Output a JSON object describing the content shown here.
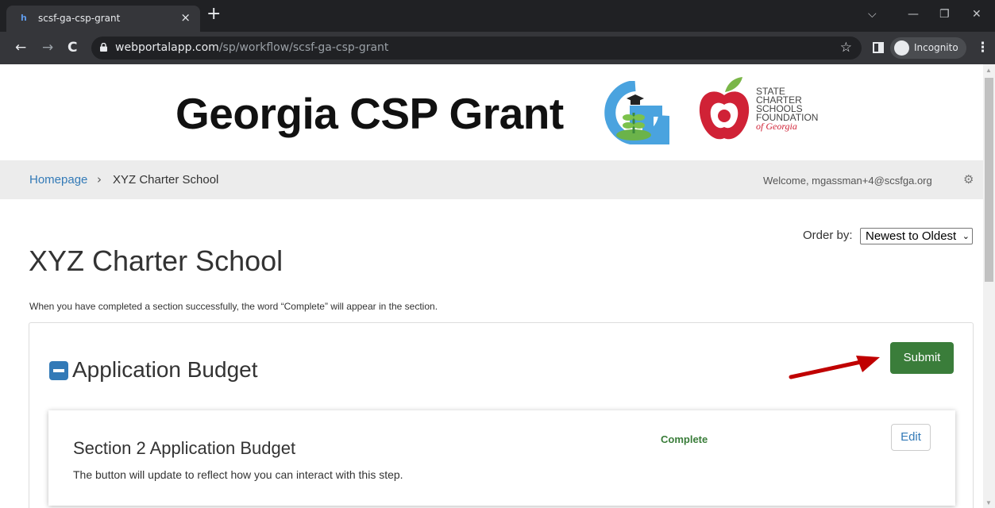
{
  "browser": {
    "tab_title": "scsf-ga-csp-grant",
    "tab_favicon": "h",
    "tab_close": "×",
    "new_tab": "+",
    "url_domain": "webportalapp.com",
    "url_path": "/sp/workflow/scsf-ga-csp-grant",
    "profile_label": "Incognito",
    "window_controls": {
      "chevron": "⌵",
      "minimize": "—",
      "restore": "❐",
      "close": "✕"
    },
    "nav": {
      "back": "←",
      "forward": "→",
      "reload": "C"
    },
    "star": "☆",
    "menu": "⋮"
  },
  "banner": {
    "title": "Georgia CSP Grant",
    "org_lines": [
      "STATE",
      "CHARTER",
      "SCHOOLS",
      "FOUNDATION"
    ],
    "org_suffix": "of Georgia"
  },
  "breadcrumb": {
    "home": "Homepage",
    "separator": "›",
    "current": "XYZ Charter School"
  },
  "user": {
    "welcome": "Welcome, mgassman+4@scsfga.org",
    "gear": "⚙"
  },
  "order_by": {
    "label": "Order by:",
    "selected": "Newest to Oldest",
    "chevron": "⌄"
  },
  "page": {
    "title": "XYZ Charter School",
    "instructions": "When you have completed a section successfully, the word “Complete” will appear in the section."
  },
  "section": {
    "title": "Application Budget",
    "submit_label": "Submit",
    "step": {
      "title": "Section 2 Application Budget",
      "status": "Complete",
      "description": "The button will update to reflect how you can interact with this step.",
      "edit_label": "Edit"
    }
  },
  "colors": {
    "primary": "#337ab7",
    "success": "#3a7d3a",
    "annotation_arrow": "#c00000",
    "brand_red": "#d02236"
  }
}
